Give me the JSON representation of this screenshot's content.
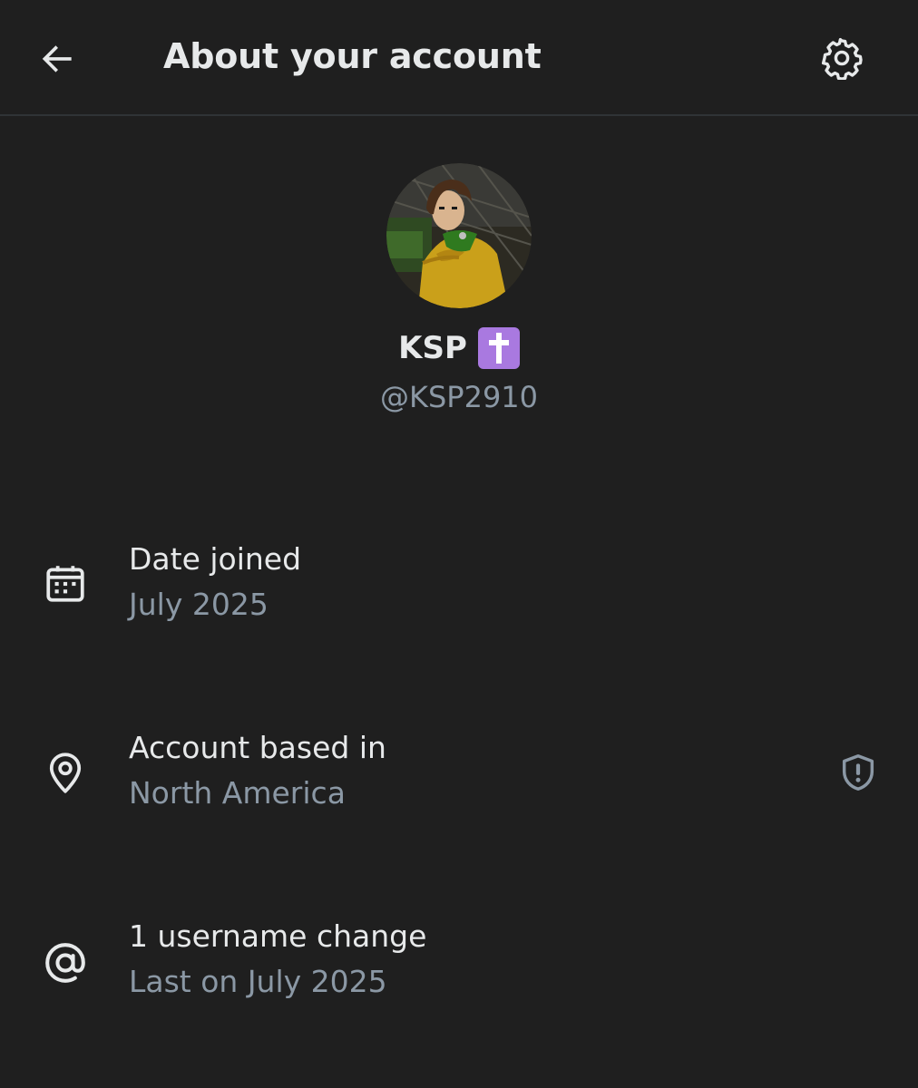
{
  "header": {
    "title": "About your account",
    "back_icon": "arrow-left-icon",
    "settings_icon": "gear-icon"
  },
  "profile": {
    "display_name": "KSP",
    "name_badge": "✝️",
    "handle": "@KSP2910",
    "avatar_icon": "avatar"
  },
  "details": {
    "date_joined": {
      "icon": "calendar-icon",
      "label": "Date joined",
      "value": "July 2025"
    },
    "based_in": {
      "icon": "location-pin-icon",
      "label": "Account based in",
      "value": "North America",
      "info_icon": "shield-exclamation-icon"
    },
    "username_changes": {
      "icon": "at-sign-icon",
      "label": "1 username change",
      "value": "Last on July 2025"
    }
  },
  "colors": {
    "background": "#1f1f1f",
    "primary_text": "#e7e9ea",
    "secondary_text": "#8b98a5",
    "divider": "#2f3336",
    "badge": "#a979e0"
  }
}
